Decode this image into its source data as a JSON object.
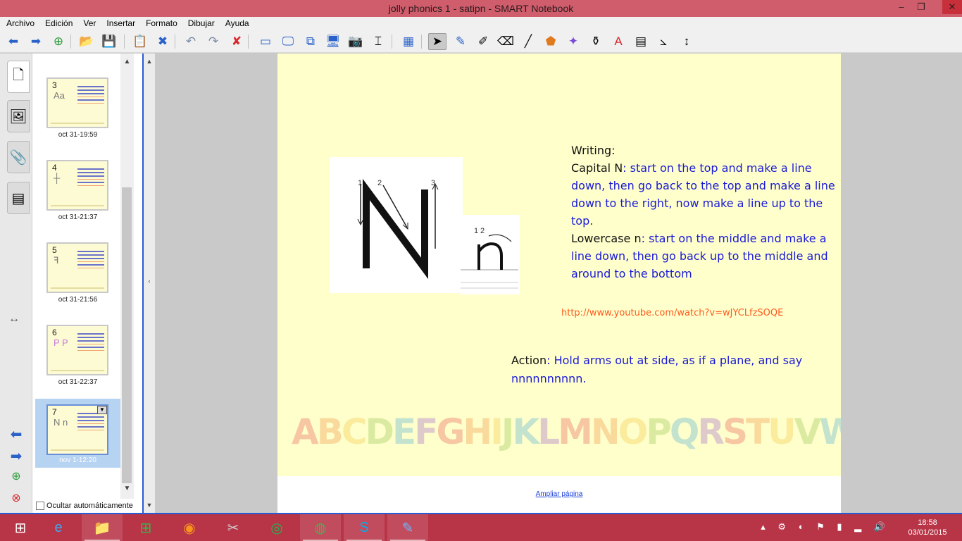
{
  "window": {
    "title": "jolly phonics 1 - satipn - SMART Notebook",
    "min_glyph": "▭",
    "max_glyph": "❐",
    "close_glyph": "✕"
  },
  "menu": [
    "Archivo",
    "Edición",
    "Ver",
    "Insertar",
    "Formato",
    "Dibujar",
    "Ayuda"
  ],
  "toolbar": {
    "icons": [
      "back-arrow-icon",
      "forward-arrow-icon",
      "add-page-icon",
      "open-folder-icon",
      "save-icon",
      "paste-icon",
      "delete-page-icon",
      "undo-icon",
      "redo-icon",
      "delete-icon",
      "screen-shade-icon",
      "full-screen-icon",
      "dual-page-icon",
      "show-screen-icon",
      "capture-icon",
      "document-camera-icon",
      "table-icon",
      "select-icon",
      "pen-icon",
      "creative-pen-icon",
      "eraser-icon",
      "line-icon",
      "shapes-icon",
      "magic-pen-icon",
      "fill-icon",
      "text-icon",
      "properties-icon",
      "measurement-tools-icon",
      "move-toolbar-icon"
    ],
    "glyphs": [
      "⬅",
      "➡",
      "⊕",
      "📂",
      "💾",
      "📋",
      "✖",
      "↶",
      "↷",
      "✘",
      "▭",
      "🖵",
      "⧉",
      "🖥",
      "📷",
      "⌶",
      "▦",
      "➤",
      "✎",
      "✐",
      "⌫",
      "╱",
      "⬟",
      "✦",
      "⚱",
      "A",
      "▤",
      "⦣",
      "↕"
    ]
  },
  "sidetabs": [
    {
      "name": "page-sorter-tab",
      "glyph": "🗋"
    },
    {
      "name": "gallery-tab",
      "glyph": "🖼"
    },
    {
      "name": "attachments-tab",
      "glyph": "📎"
    },
    {
      "name": "properties-tab",
      "glyph": "▤"
    }
  ],
  "sorter": {
    "pages": [
      {
        "num": "3",
        "date": "oct 31-19:59",
        "glyph": "Aa"
      },
      {
        "num": "4",
        "date": "oct 31-21:37",
        "glyph": "┼"
      },
      {
        "num": "5",
        "date": "oct 31-21:56",
        "glyph": "ꟻ"
      },
      {
        "num": "6",
        "date": "oct 31-22:37",
        "glyph": "P P"
      },
      {
        "num": "7",
        "date": "nov 1-12:20",
        "glyph": "N n"
      }
    ],
    "autohide_label": "Ocultar automáticamente",
    "resize_glyph": "↔",
    "nav": [
      "⬅",
      "➡",
      "⊕",
      "⊗"
    ]
  },
  "page": {
    "writing_heading": "Writing:",
    "capital_label": "Capital N",
    "capital_text": ": start on the top and make a line down, then go back to the top and make a line down to the right, now make a line up to the top.",
    "lowercase_label": "Lowercase n",
    "lowercase_text": ": start on the middle and make a line down, then go back up to the middle and around to the bottom",
    "youtube_link": "http://www.youtube.com/watch?v=wJYCLfzSOQE",
    "action_label": "Action",
    "action_text": ": Hold arms out at side, as if a plane, and say nnnnnnnnnn.",
    "alphabet": "ABCDEFGHIJKLMNOPQRSTUVWXYZ",
    "alphabet_colors": [
      "#e8554e",
      "#f08a3c",
      "#f0c23c",
      "#8fc24a",
      "#4aa9d8",
      "#9b59c9",
      "#e8554e",
      "#f08a3c",
      "#f0c23c",
      "#8fc24a",
      "#4aa9d8",
      "#9b59c9",
      "#e8554e",
      "#f08a3c",
      "#f0c23c",
      "#8fc24a",
      "#4aa9d8",
      "#9b59c9",
      "#e8554e",
      "#f08a3c",
      "#f0c23c",
      "#8fc24a",
      "#4aa9d8",
      "#9b59c9",
      "#e8554e",
      "#f08a3c"
    ],
    "enlarge_link": "Ampliar página",
    "image_numbers": [
      "1",
      "2",
      "3",
      "1",
      "2"
    ]
  },
  "taskbar": {
    "apps": [
      {
        "name": "start-button",
        "glyph": "⊞",
        "open": false
      },
      {
        "name": "internet-explorer-task",
        "glyph": "e",
        "open": false
      },
      {
        "name": "file-explorer-task",
        "glyph": "📁",
        "open": true
      },
      {
        "name": "store-task",
        "glyph": "⊞",
        "open": false
      },
      {
        "name": "color-app-task",
        "glyph": "◉",
        "open": false
      },
      {
        "name": "tools-app-task",
        "glyph": "✂",
        "open": false
      },
      {
        "name": "spotify-task",
        "glyph": "◎",
        "open": false
      },
      {
        "name": "chrome-task",
        "glyph": "◍",
        "open": true
      },
      {
        "name": "skype-task",
        "glyph": "S",
        "open": true
      },
      {
        "name": "smart-notebook-task",
        "glyph": "✎",
        "open": true
      }
    ],
    "tray_glyphs": "▴ ⚙ ◐ ⚑ ▮ ▂ 🔊",
    "time": "18:58",
    "date": "03/01/2015"
  }
}
